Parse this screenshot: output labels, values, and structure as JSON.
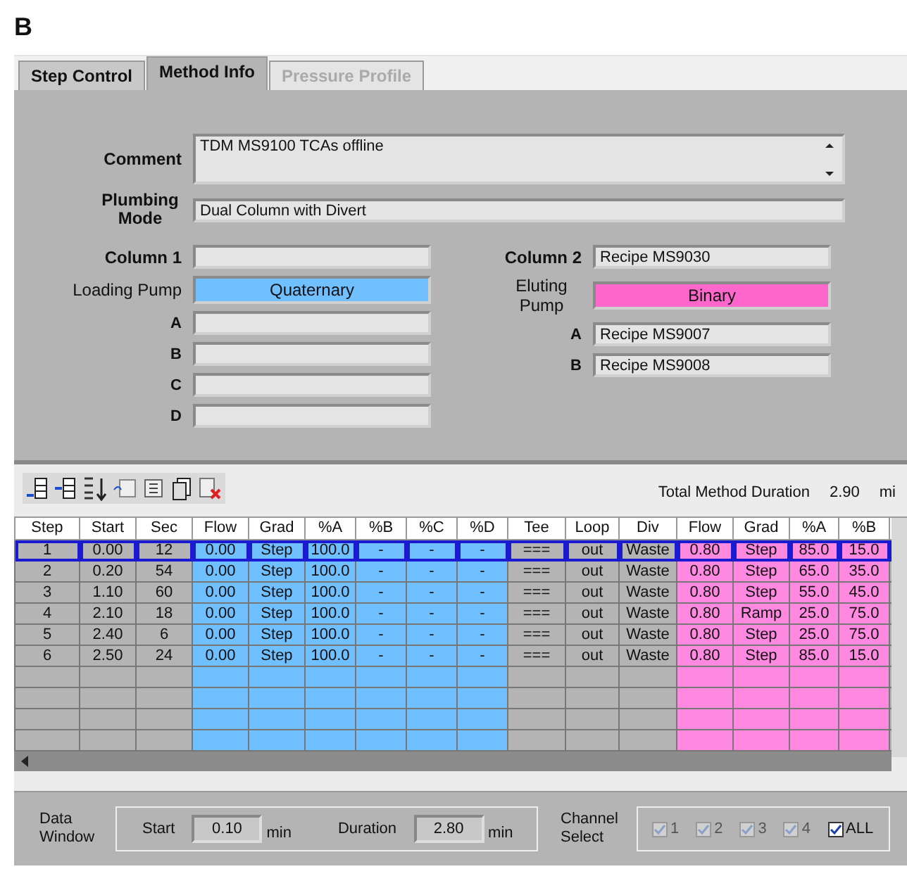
{
  "figure_label": "B",
  "tabs": [
    {
      "label": "Step Control",
      "selected": false,
      "disabled": false
    },
    {
      "label": "Method Info",
      "selected": true,
      "disabled": false
    },
    {
      "label": "Pressure Profile",
      "selected": false,
      "disabled": true
    }
  ],
  "method_info": {
    "comment": {
      "label": "Comment",
      "value": "TDM MS9100 TCAs offline"
    },
    "plumbing_mode": {
      "label": "Plumbing Mode",
      "value": "Dual Column with Divert"
    },
    "left": [
      {
        "label": "Column 1",
        "kind": "column"
      },
      {
        "label": "Loading Pump",
        "kind": "pump",
        "value": "Quaternary",
        "color": "#70bfff"
      },
      {
        "label": "A",
        "kind": "channel"
      },
      {
        "label": "B",
        "kind": "channel"
      },
      {
        "label": "C",
        "kind": "channel"
      },
      {
        "label": "D",
        "kind": "channel"
      }
    ],
    "right": [
      {
        "label": "Column 2",
        "kind": "column",
        "value": "Recipe MS9030"
      },
      {
        "label": "Eluting Pump",
        "kind": "pump",
        "value": "Binary",
        "color": "#ff66cc"
      },
      {
        "label": "A",
        "kind": "channel",
        "value": "Recipe MS9007"
      },
      {
        "label": "B",
        "kind": "channel",
        "value": "Recipe MS9008"
      }
    ]
  },
  "total_duration": {
    "label": "Total Method Duration",
    "value": "2.90",
    "unit": "mi"
  },
  "table": {
    "columns": [
      {
        "label": "Step",
        "kind": "general"
      },
      {
        "label": "Start",
        "kind": "general"
      },
      {
        "label": "Sec",
        "kind": "general"
      },
      {
        "label": "Flow",
        "kind": "loading"
      },
      {
        "label": "Grad",
        "kind": "loading"
      },
      {
        "label": "%A",
        "kind": "loading"
      },
      {
        "label": "%B",
        "kind": "loading"
      },
      {
        "label": "%C",
        "kind": "loading"
      },
      {
        "label": "%D",
        "kind": "loading"
      },
      {
        "label": "Tee",
        "kind": "general"
      },
      {
        "label": "Loop",
        "kind": "general"
      },
      {
        "label": "Div",
        "kind": "general"
      },
      {
        "label": "Flow",
        "kind": "eluting"
      },
      {
        "label": "Grad",
        "kind": "eluting"
      },
      {
        "label": "%A",
        "kind": "eluting"
      },
      {
        "label": "%B",
        "kind": "eluting"
      }
    ],
    "rows": [
      {
        "selected": true,
        "cells": [
          "1",
          "0.00",
          "12",
          "0.00",
          "Step",
          "100.0",
          "-",
          "-",
          "-",
          "===",
          "out",
          "Waste",
          "0.80",
          "Step",
          "85.0",
          "15.0"
        ]
      },
      {
        "selected": false,
        "cells": [
          "2",
          "0.20",
          "54",
          "0.00",
          "Step",
          "100.0",
          "-",
          "-",
          "-",
          "===",
          "out",
          "Waste",
          "0.80",
          "Step",
          "65.0",
          "35.0"
        ]
      },
      {
        "selected": false,
        "cells": [
          "3",
          "1.10",
          "60",
          "0.00",
          "Step",
          "100.0",
          "-",
          "-",
          "-",
          "===",
          "out",
          "Waste",
          "0.80",
          "Step",
          "55.0",
          "45.0"
        ]
      },
      {
        "selected": false,
        "cells": [
          "4",
          "2.10",
          "18",
          "0.00",
          "Step",
          "100.0",
          "-",
          "-",
          "-",
          "===",
          "out",
          "Waste",
          "0.80",
          "Ramp",
          "25.0",
          "75.0"
        ]
      },
      {
        "selected": false,
        "cells": [
          "5",
          "2.40",
          "6",
          "0.00",
          "Step",
          "100.0",
          "-",
          "-",
          "-",
          "===",
          "out",
          "Waste",
          "0.80",
          "Step",
          "25.0",
          "75.0"
        ]
      },
      {
        "selected": false,
        "cells": [
          "6",
          "2.50",
          "24",
          "0.00",
          "Step",
          "100.0",
          "-",
          "-",
          "-",
          "===",
          "out",
          "Waste",
          "0.80",
          "Step",
          "85.0",
          "15.0"
        ]
      }
    ]
  },
  "data_window": {
    "label": "Data Window",
    "start_label": "Start",
    "start": "0.10",
    "start_unit": "min",
    "duration_label": "Duration",
    "duration": "2.80",
    "duration_unit": "min"
  },
  "channel_select": {
    "label": "Channel Select",
    "channels": [
      {
        "label": "1",
        "checked": true,
        "disabled": true
      },
      {
        "label": "2",
        "checked": true,
        "disabled": true
      },
      {
        "label": "3",
        "checked": true,
        "disabled": true
      },
      {
        "label": "4",
        "checked": true,
        "disabled": true
      },
      {
        "label": "ALL",
        "checked": true,
        "disabled": false
      }
    ]
  }
}
